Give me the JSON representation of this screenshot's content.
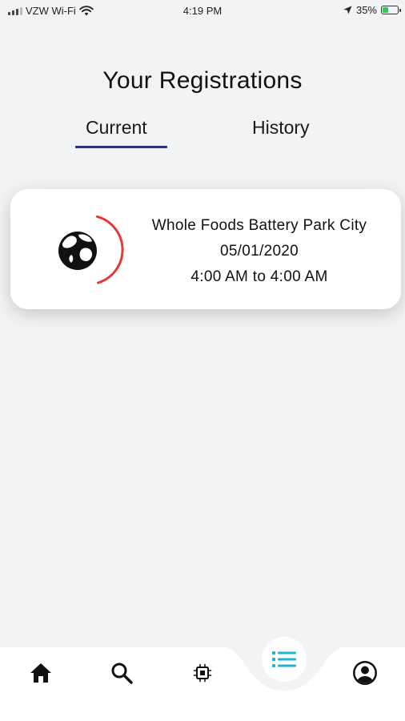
{
  "status_bar": {
    "carrier": "VZW Wi-Fi",
    "time": "4:19 PM",
    "battery_percent": "35%",
    "battery_level": 0.35
  },
  "header": {
    "title": "Your Registrations"
  },
  "tabs": [
    {
      "label": "Current",
      "active": true
    },
    {
      "label": "History",
      "active": false
    }
  ],
  "registrations": [
    {
      "store": "Whole Foods Battery Park City",
      "date": "05/01/2020",
      "time_range": "4:00 AM to 4:00 AM",
      "icon": "globe-icon"
    }
  ],
  "bottom_nav": {
    "items": [
      {
        "name": "home",
        "icon": "home-icon"
      },
      {
        "name": "search",
        "icon": "search-icon"
      },
      {
        "name": "chip",
        "icon": "chip-icon"
      },
      {
        "name": "list",
        "icon": "list-icon",
        "active": true
      },
      {
        "name": "profile",
        "icon": "profile-icon"
      }
    ]
  },
  "colors": {
    "background": "#f2f3f5",
    "tab_indicator": "#2b2e7a",
    "accent_arc": "#e53935",
    "active_nav": "#1bb6d6"
  }
}
